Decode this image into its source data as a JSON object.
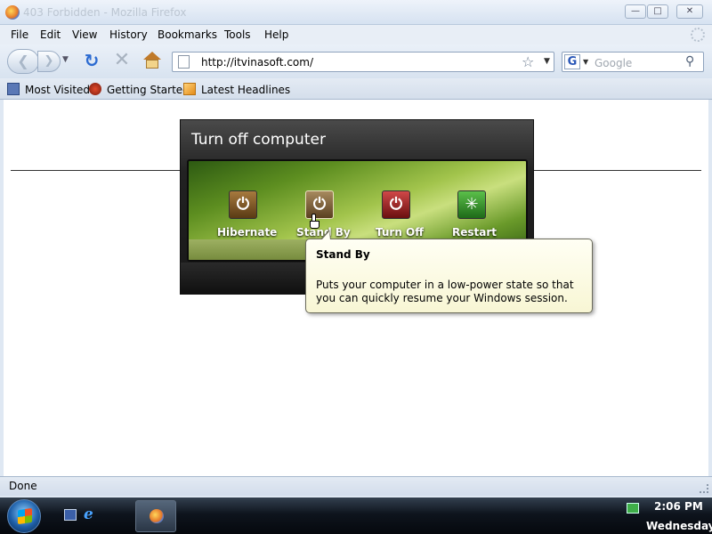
{
  "window": {
    "title": "403 Forbidden - Mozilla Firefox",
    "controls": {
      "minimize": "—",
      "maximize": "□",
      "close": "✕"
    }
  },
  "menu": [
    "File",
    "Edit",
    "View",
    "History",
    "Bookmarks",
    "Tools",
    "Help"
  ],
  "navbar": {
    "back_icon": "back-arrow-icon",
    "forward_icon": "forward-arrow-icon",
    "reload_icon": "reload-icon",
    "stop_icon": "stop-icon",
    "home_icon": "home-icon",
    "url": "http://itvinasoft.com/",
    "search_placeholder": "Google"
  },
  "bookmarks": [
    "Most Visited",
    "Getting Started",
    "Latest Headlines"
  ],
  "dialog": {
    "title": "Turn off computer",
    "buttons": [
      {
        "label": "Hibernate",
        "icon": "power-icon",
        "color": "#8a5a24"
      },
      {
        "label": "Stand By",
        "icon": "power-icon",
        "color": "#8a6a40"
      },
      {
        "label": "Turn Off",
        "icon": "power-icon",
        "color": "#b02828"
      },
      {
        "label": "Restart",
        "icon": "restart-icon",
        "color": "#3a9a30"
      }
    ]
  },
  "tooltip": {
    "title": "Stand By",
    "body": "Puts your computer in a low-power state so that you can quickly resume your Windows session."
  },
  "status": {
    "text": "Done"
  },
  "taskbar": {
    "time": "2:06 PM",
    "day": "Wednesday"
  }
}
